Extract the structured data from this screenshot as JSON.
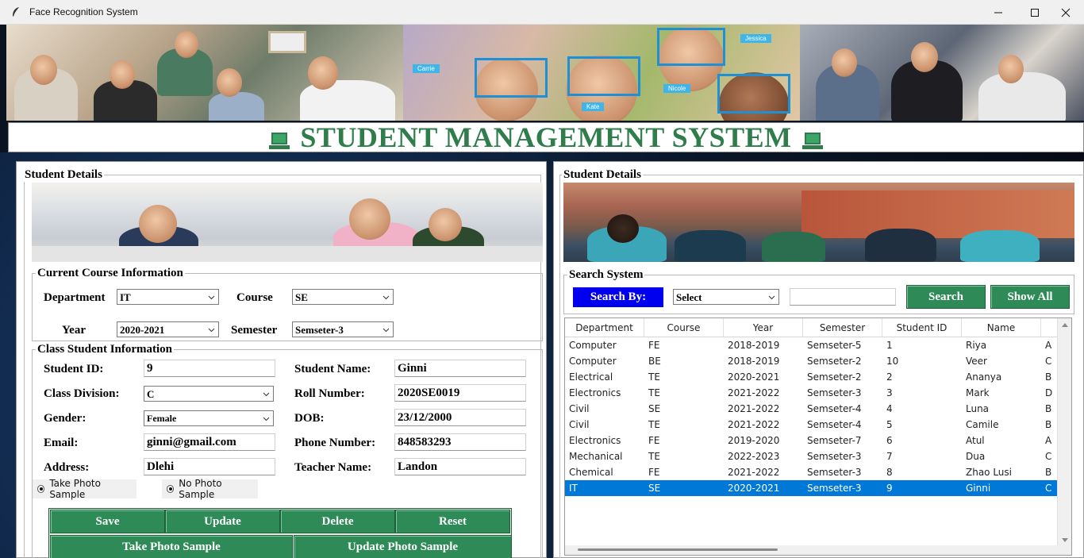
{
  "window": {
    "title": "Face Recognition System"
  },
  "banner": {
    "face_tags": [
      "Carrie",
      "Jessica",
      "Nicole",
      "Kate"
    ]
  },
  "header": {
    "title": "STUDENT MANAGEMENT SYSTEM"
  },
  "left": {
    "frame_label": "Student Details",
    "course_info": {
      "label": "Current Course Information",
      "department_label": "Department",
      "department_value": "IT",
      "course_label": "Course",
      "course_value": "SE",
      "year_label": "Year",
      "year_value": "2020-2021",
      "semester_label": "Semester",
      "semester_value": "Semseter-3"
    },
    "class_info": {
      "label": "Class Student Information",
      "student_id_label": "Student ID:",
      "student_id_value": "9",
      "student_name_label": "Student Name:",
      "student_name_value": "Ginni",
      "class_division_label": "Class Division:",
      "class_division_value": "C",
      "roll_number_label": "Roll Number:",
      "roll_number_value": "2020SE0019",
      "gender_label": "Gender:",
      "gender_value": "Female",
      "dob_label": "DOB:",
      "dob_value": "23/12/2000",
      "email_label": "Email:",
      "email_value": "ginni@gmail.com",
      "phone_label": "Phone Number:",
      "phone_value": "848583293",
      "address_label": "Address:",
      "address_value": "Dlehi",
      "teacher_label": "Teacher Name:",
      "teacher_value": "Landon",
      "radio_take": "Take Photo Sample",
      "radio_no": "No Photo Sample"
    },
    "buttons": {
      "save": "Save",
      "update": "Update",
      "delete": "Delete",
      "reset": "Reset",
      "take_photo": "Take Photo Sample",
      "update_photo": "Update Photo Sample"
    }
  },
  "right": {
    "frame_label": "Student Details",
    "search": {
      "label": "Search System",
      "search_by": "Search By:",
      "select_value": "Select",
      "search_text": "",
      "search_button": "Search",
      "show_all_button": "Show All"
    },
    "table": {
      "columns": [
        "Department",
        "Course",
        "Year",
        "Semester",
        "Student ID",
        "Name"
      ],
      "rows": [
        [
          "Computer",
          "FE",
          "2018-2019",
          "Semseter-5",
          "1",
          "Riya",
          "A"
        ],
        [
          "Computer",
          "BE",
          "2018-2019",
          "Semseter-2",
          "10",
          "Veer",
          "C"
        ],
        [
          "Electrical",
          "TE",
          "2020-2021",
          "Semseter-2",
          "2",
          "Ananya",
          "B"
        ],
        [
          "Electronics",
          "TE",
          "2021-2022",
          "Semseter-3",
          "3",
          "Mark",
          "D"
        ],
        [
          "Civil",
          "SE",
          "2021-2022",
          "Semseter-4",
          "4",
          "Luna",
          "B"
        ],
        [
          "Civil",
          "TE",
          "2021-2022",
          "Semseter-4",
          "5",
          "Camile",
          "B"
        ],
        [
          "Electronics",
          "FE",
          "2019-2020",
          "Semseter-7",
          "6",
          "Atul",
          "A"
        ],
        [
          "Mechanical",
          "TE",
          "2022-2023",
          "Semseter-3",
          "7",
          "Dua",
          "C"
        ],
        [
          "Chemical",
          "FE",
          "2021-2022",
          "Semseter-3",
          "8",
          "Zhao Lusi",
          "B"
        ],
        [
          "IT",
          "SE",
          "2020-2021",
          "Semseter-3",
          "9",
          "Ginni",
          "C"
        ]
      ],
      "selected_row": 9
    }
  },
  "colors": {
    "accent_green": "#2e8b57",
    "title_green": "#2e7d4a",
    "search_by_blue": "#0000ee",
    "selection_blue": "#0078d7"
  }
}
